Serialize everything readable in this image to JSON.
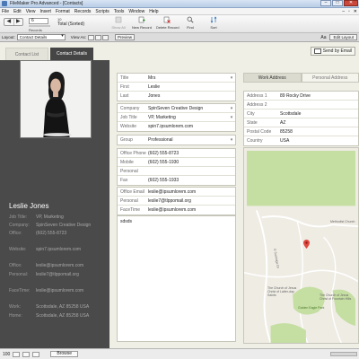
{
  "window": {
    "title": "FileMaker Pro Advanced - [Contacts]",
    "buttons": [
      "–",
      "□",
      "✕"
    ]
  },
  "menu": [
    "File",
    "Edit",
    "View",
    "Insert",
    "Format",
    "Records",
    "Scripts",
    "Tools",
    "Window",
    "Help"
  ],
  "menu_right": [
    "–",
    "▫",
    "✕"
  ],
  "toolbar": {
    "nav_prev": "◀",
    "nav_next": "▶",
    "current_record": "6",
    "found_count": "10",
    "total_label": "Total (Sorted)",
    "records_label": "Records",
    "buttons": [
      {
        "label": "Show All",
        "icon": "show-all-icon",
        "disabled": true
      },
      {
        "label": "New Record",
        "icon": "new-record-icon",
        "disabled": false
      },
      {
        "label": "Delete Record",
        "icon": "delete-record-icon",
        "disabled": false
      },
      {
        "label": "Find",
        "icon": "find-icon",
        "disabled": false
      },
      {
        "label": "Sort",
        "icon": "sort-icon",
        "disabled": false
      }
    ]
  },
  "layoutbar": {
    "layout_label": "Layout:",
    "layout_value": "Contact Details",
    "view_as_label": "View As:",
    "preview_label": "Preview",
    "aa_label": "Aa",
    "edit_label": "Edit Layout"
  },
  "tabs": {
    "contact_list": "Contact List",
    "contact_details": "Contact Details"
  },
  "send_email_label": "Send by Email",
  "profile": {
    "name": "Leslie Jones",
    "job_title_label": "Job Title:",
    "job_title": "VP, Marketing",
    "company_label": "Company:",
    "company": "SpinSeven Creative Design",
    "office_label": "Office:",
    "office": "(602) 555-8723",
    "website_label": "Website:",
    "website": "spin7.ipsumlorem.com",
    "office_email_label": "Office:",
    "office_email": "leslie@ipsumlorem.com",
    "personal_email_label": "Personal:",
    "personal_email": "leslie7@tlppomail.org",
    "facetime_label": "FaceTime:",
    "facetime": "leslie@ipsumlorem.com",
    "work_label": "Work:",
    "work_address": "Scottsdale, AZ 85258 USA",
    "home_label": "Home:",
    "home_address": "Scottsdale, AZ 85258 USA"
  },
  "form": {
    "name_group": [
      {
        "label": "Title",
        "value": "Mrs",
        "dropdown": true
      },
      {
        "label": "First",
        "value": "Leslie",
        "dropdown": false
      },
      {
        "label": "Last",
        "value": "Jones",
        "dropdown": false
      }
    ],
    "company_group": [
      {
        "label": "Company",
        "value": "SpinSeven Creative Design",
        "dropdown": true
      },
      {
        "label": "Job Title",
        "value": "VP, Marketing",
        "dropdown": true
      },
      {
        "label": "Website",
        "value": "spin7.ipsumlorem.com",
        "dropdown": false
      }
    ],
    "group_group": [
      {
        "label": "Group",
        "value": "Professional",
        "dropdown": true
      }
    ],
    "phone_group": [
      {
        "label": "Office Phone",
        "value": "(602) 555-8723",
        "dropdown": false
      },
      {
        "label": "Mobile",
        "value": "(602) 555-1930",
        "dropdown": false
      },
      {
        "label": "Personal",
        "value": "",
        "dropdown": false
      },
      {
        "label": "Fax",
        "value": "(602) 555-1933",
        "dropdown": false
      }
    ],
    "email_group": [
      {
        "label": "Office Email",
        "value": "leslie@ipsumlorem.com",
        "dropdown": false
      },
      {
        "label": "Personal",
        "value": "leslie7@tlppomail.org",
        "dropdown": false
      },
      {
        "label": "FaceTime",
        "value": "leslie@ipsumlorem.com",
        "dropdown": false
      }
    ],
    "notes": "sdsds"
  },
  "address": {
    "tab_work": "Work Address",
    "tab_personal": "Personal Address",
    "rows": [
      {
        "label": "Address 1",
        "value": "89 Rocky Drive"
      },
      {
        "label": "Address 2",
        "value": ""
      },
      {
        "label": "City",
        "value": "Scottsdale"
      },
      {
        "label": "State",
        "value": "AZ"
      },
      {
        "label": "Postal Code",
        "value": "85258"
      },
      {
        "label": "Country",
        "value": "USA"
      }
    ]
  },
  "map": {
    "labels": [
      "Methodist Church",
      "The Church of Jesus Christ of Latter-day Saints",
      "The Church of Jesus Christ of Fountain Hills",
      "Golden Eagle Park",
      "E Sunridge Dr"
    ]
  },
  "status": {
    "zoom": "100",
    "mode": "Browse"
  },
  "colors": {
    "dark_panel": "#4a4a4a",
    "form_bg": "#f0efe6",
    "map_park": "#c5dea2",
    "map_pin": "#e0473d"
  }
}
